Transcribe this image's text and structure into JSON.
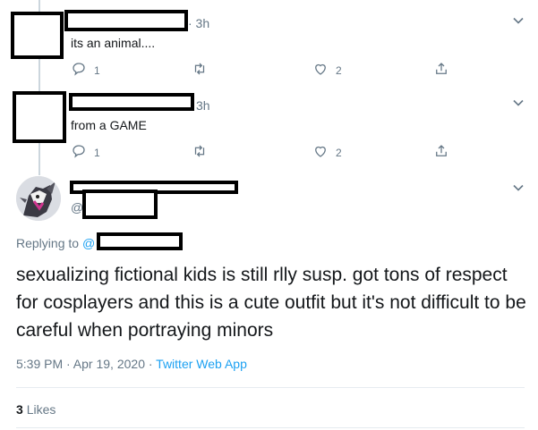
{
  "tweet1": {
    "time": "· 3h",
    "text": "its an animal....",
    "reply_count": "1",
    "like_count": "2"
  },
  "tweet2": {
    "time": "3h",
    "text": "from a GAME",
    "reply_count": "1",
    "like_count": "2"
  },
  "main": {
    "handle_prefix": "@",
    "replying_label": "Replying to",
    "replying_at": "@",
    "text": "sexualizing fictional kids is still rlly susp. got tons of respect for cosplayers and this is a cute outfit but it's not difficult to be careful when portraying minors",
    "timestamp": "5:39 PM · Apr 19, 2020 ·",
    "source": "Twitter Web App",
    "likes_count": "3",
    "likes_label": "Likes"
  },
  "colors": {
    "accent": "#1da1f2",
    "muted": "#657786",
    "text": "#14171a",
    "line": "#ccd6dd"
  }
}
